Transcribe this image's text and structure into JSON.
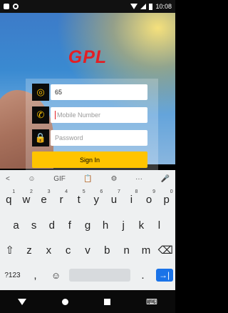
{
  "status": {
    "time": "10:08"
  },
  "app": {
    "logo": "GPL",
    "code_value": "65",
    "mobile_placeholder": "Mobile Number",
    "password_placeholder": "Password",
    "signin_label": "Sign In"
  },
  "keyboard": {
    "toolbar": [
      "<",
      "☺",
      "GIF",
      "📋",
      "⚙",
      "···",
      "🎤"
    ],
    "row1": [
      {
        "k": "q",
        "s": "1"
      },
      {
        "k": "w",
        "s": "2"
      },
      {
        "k": "e",
        "s": "3"
      },
      {
        "k": "r",
        "s": "4"
      },
      {
        "k": "t",
        "s": "5"
      },
      {
        "k": "y",
        "s": "6"
      },
      {
        "k": "u",
        "s": "7"
      },
      {
        "k": "i",
        "s": "8"
      },
      {
        "k": "o",
        "s": "9"
      },
      {
        "k": "p",
        "s": "0"
      }
    ],
    "row2": [
      "a",
      "s",
      "d",
      "f",
      "g",
      "h",
      "j",
      "k",
      "l"
    ],
    "row3": [
      "⇧",
      "z",
      "x",
      "c",
      "v",
      "b",
      "n",
      "m",
      "⌫"
    ],
    "row4": [
      "?123",
      ",",
      "☺",
      "",
      ".",
      "→|"
    ]
  }
}
